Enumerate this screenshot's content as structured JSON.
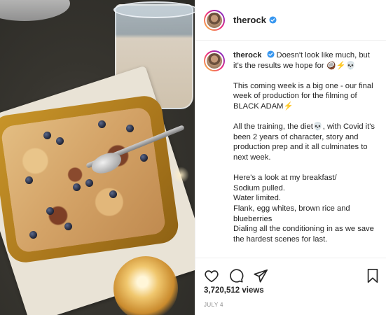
{
  "post": {
    "author": {
      "username": "therock",
      "verified": true
    },
    "caption": {
      "username": "therock",
      "paragraphs": [
        "Doesn't look like much, but it's the results we hope for 🥥⚡💀",
        "This coming week is a big one - our final week of production for the filming of BLACK ADAM⚡",
        "All the training, the diet💀, with Covid it's been 2 years of character, story and production prep and it all culminates to next week.",
        "Here's a look at my breakfast/\nSodium pulled.\nWater limited.\nFlank, egg whites, brown rice and blueberries\nDialing all the conditioning in as we save the hardest scenes for last."
      ]
    },
    "stats": {
      "views": "3,720,512 views",
      "date": "JULY 4"
    },
    "icons": [
      "heart-icon",
      "comment-icon",
      "share-icon",
      "bookmark-icon",
      "verified-badge-icon"
    ],
    "colors": {
      "verified": "#3897f0",
      "text": "#262626",
      "muted": "#8e8e8e",
      "border": "#efefef"
    }
  }
}
